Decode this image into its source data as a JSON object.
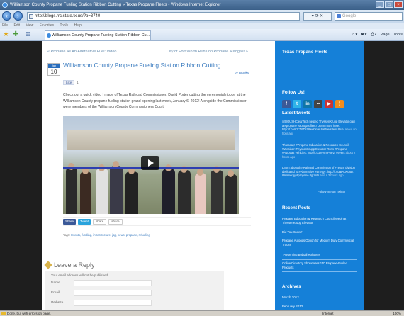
{
  "window": {
    "title": "Williamson County Propane Fueling Station Ribbon Cutting » Texas Propane Fleets - Windows Internet Explorer",
    "controls": [
      "_",
      "□",
      "×"
    ]
  },
  "addressbar": {
    "url": "http://blogs.rrc.state.tx.us/?p=3740",
    "search_placeholder": "Google"
  },
  "menu": {
    "items": [
      "File",
      "Edit",
      "View",
      "Favorites",
      "Tools",
      "Help"
    ]
  },
  "tab": {
    "label": "Williamson County Propane Fueling Station Ribbon Cu..."
  },
  "commandbar": {
    "page": "Page",
    "tools": "Tools"
  },
  "post": {
    "prev_link": "« Propane As An Alternative Fuel: Video",
    "next_link": "City of Fort Worth Runs on Propane Autogas! »",
    "date_month": "Jan",
    "date_day": "10",
    "title": "Williamson County Propane Fueling Station Ribbon Cutting",
    "byline": "by Brooks",
    "like_label": "Like",
    "like_count": "1",
    "body": "Check out a quick video I made of Texas Railroad Commissioner, David Porter cutting the ceremonial ribbon at the Williamson County propane fueling station grand opening last week, January 6, 2012! Alongside the Commissioner were members of the Williamson County Commissioners Court.",
    "share_buttons": [
      "Share",
      "Tweet",
      "share",
      "share"
    ],
    "tags_label": "Tags:",
    "tags": "Events, funding, infrastructure, jsg, news, propane, refueling"
  },
  "reply": {
    "title": "Leave a Reply",
    "note": "Your email address will not be published.",
    "fields": [
      "Name",
      "Email",
      "Website"
    ]
  },
  "sidebar": {
    "site_title": "Texas Propane Fleets",
    "follow_heading": "Follow Us!",
    "social": [
      {
        "icon": "facebook-icon",
        "glyph": "f"
      },
      {
        "icon": "twitter-icon",
        "glyph": "t"
      },
      {
        "icon": "linkedin-icon",
        "glyph": "in"
      },
      {
        "icon": "flickr-icon",
        "glyph": "••"
      },
      {
        "icon": "youtube-icon",
        "glyph": "▶"
      },
      {
        "icon": "rss-icon",
        "glyph": ")"
      }
    ],
    "tweets_heading": "Latest tweets",
    "tweets": [
      {
        "text": "@DOUSHClearTech helped ThyssenKrupp Elevator gain a #propane #autogas fleet! Learn more here: http://t.co/CC7f6Dsf #webinar #altfuelsfleet #fuel",
        "ago": "about an hour ago"
      },
      {
        "text": "Thursday! #Propane Education & Research Council #Webinar: ThyssenKrupp Elevator Runs #Propane #Autogas Vehicles: http://t.co/WVmPnP2I #event",
        "ago": "about 2 hours ago"
      },
      {
        "text": "Learn about the Railroad Commission of #Texas' division dedicated to #Alternative #Energy: http://t.co/BALKcaBt #altenergy #propane #grants",
        "ago": "about 3 hours ago"
      }
    ],
    "follow_twitter": "Follow me on Twitter",
    "recent_heading": "Recent Posts",
    "recent_posts": [
      "Propane Education & Research Council Webinar: ThyssenKrupp Elevator",
      "Did You Know?",
      "Propane Autogas Option for Medium Duty Commercial Trucks",
      "\"Presenting Bobtail Rollovers\"",
      "Online Directory Showcases 170 Propane-Fueled Products"
    ],
    "archives_heading": "Archives",
    "archives": [
      "March 2012",
      "February 2012"
    ]
  },
  "status": {
    "text": "Done, but with errors on page.",
    "zone": "Internet",
    "zoom": "100%"
  }
}
